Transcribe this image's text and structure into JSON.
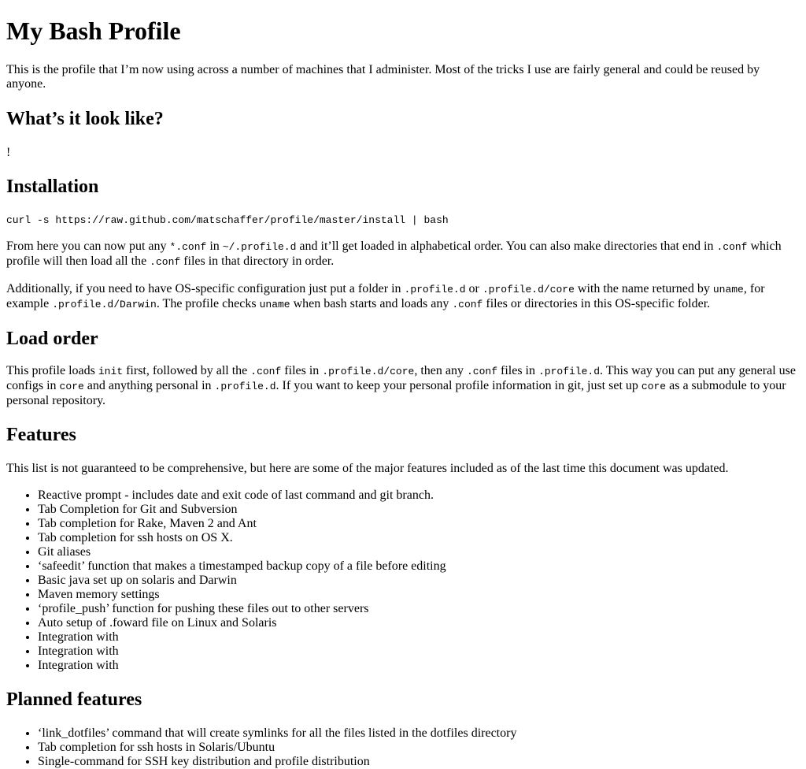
{
  "page": {
    "title": "My Bash Profile",
    "intro": "This is the profile that I’m now using across a number of machines that I administer. Most of the tricks I use are fairly general and could be reused by anyone."
  },
  "sections": {
    "look": {
      "heading": "What’s it look like?",
      "text": "!"
    },
    "installation": {
      "heading": "Installation",
      "command": "curl -s https://raw.github.com/matschaffer/profile/master/install | bash",
      "p1": {
        "t1": "From here you can now put any ",
        "c1": "*.conf",
        "t2": " in ",
        "c2": "~/.profile.d",
        "t3": " and it’ll get loaded in alphabetical order. You can also make directories that end in ",
        "c3": ".conf",
        "t4": " which profile will then load all the ",
        "c4": ".conf",
        "t5": " files in that directory in order."
      },
      "p2": {
        "t1": "Additionally, if you need to have OS-specific configuration just put a folder in ",
        "c1": ".profile.d",
        "t2": " or ",
        "c2": ".profile.d/core",
        "t3": " with the name returned by ",
        "c3": "uname",
        "t4": ", for example ",
        "c4": ".profile.d/Darwin",
        "t5": ". The profile checks ",
        "c5": "uname",
        "t6": " when bash starts and loads any ",
        "c6": ".conf",
        "t7": " files or directories in this OS-specific folder."
      }
    },
    "load_order": {
      "heading": "Load order",
      "p1": {
        "t1": "This profile loads ",
        "c1": "init",
        "t2": " first, followed by all the ",
        "c2": ".conf",
        "t3": " files in ",
        "c3": ".profile.d/core",
        "t4": ", then any ",
        "c4": ".conf",
        "t5": " files in ",
        "c5": ".profile.d",
        "t6": ". This way you can put any general use configs in ",
        "c6": "core",
        "t7": " and anything personal in ",
        "c7": ".profile.d",
        "t8": ". If you want to keep your personal profile information in git, just set up ",
        "c8": "core",
        "t9": " as a submodule to your personal repository."
      }
    },
    "features": {
      "heading": "Features",
      "intro": "This list is not guaranteed to be comprehensive, but here are some of the major features included as of the last time this document was updated.",
      "items": [
        "Reactive prompt - includes date and exit code of last command and git branch.",
        "Tab Completion for Git and Subversion",
        "Tab completion for Rake, Maven 2 and Ant",
        "Tab completion for ssh hosts on OS X.",
        "Git aliases",
        "‘safeedit’ function that makes a timestamped backup copy of a file before editing",
        "Basic java set up on solaris and Darwin",
        "Maven memory settings",
        "‘profile_push’ function for pushing these files out to other servers",
        "Auto setup of .foward file on Linux and Solaris",
        "Integration with",
        "Integration with",
        "Integration with"
      ]
    },
    "planned": {
      "heading": "Planned features",
      "items": [
        "‘link_dotfiles’ command that will create symlinks for all the files listed in the dotfiles directory",
        "Tab completion for ssh hosts in Solaris/Ubuntu",
        "Single-command for SSH key distribution and profile distribution"
      ]
    }
  }
}
